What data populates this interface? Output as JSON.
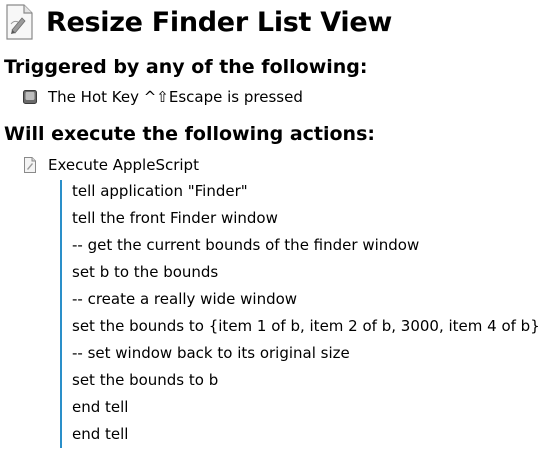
{
  "macro": {
    "title": "Resize Finder List View"
  },
  "triggers": {
    "heading": "Triggered by any of the following:",
    "items": [
      {
        "text": "The Hot Key ^⇧Escape is pressed"
      }
    ]
  },
  "actions": {
    "heading": "Will execute the following actions:",
    "items": [
      {
        "label": "Execute AppleScript",
        "script_lines": [
          "tell application \"Finder\"",
          "tell the front Finder window",
          "-- get the current bounds of the finder window",
          "set b to the bounds",
          "-- create a really wide window",
          "set the bounds to {item 1 of b, item 2 of b, 3000, item 4 of b}",
          "-- set window back to its original size",
          "set the bounds to b",
          "end tell",
          "end tell"
        ]
      }
    ]
  },
  "colors": {
    "script_border": "#2a8fc9"
  },
  "icons": {
    "title": "script-document-icon",
    "trigger": "keyboard-key-icon",
    "action": "applescript-document-icon"
  }
}
